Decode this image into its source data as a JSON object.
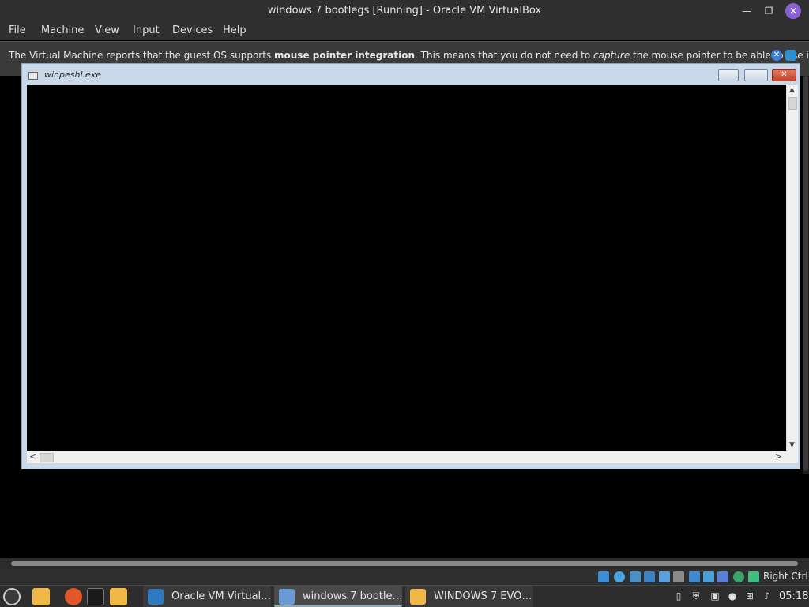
{
  "window": {
    "title": "windows 7 bootlegs [Running] - Oracle VM VirtualBox",
    "min_glyph": "—",
    "max_glyph": "❐",
    "close_glyph": "✕"
  },
  "menu": {
    "items": [
      "File",
      "Machine",
      "View",
      "Input",
      "Devices",
      "Help"
    ]
  },
  "notice": {
    "text_1": "The Virtual Machine reports that the guest OS supports ",
    "bold": "mouse pointer integration",
    "text_2": ". This means that you do not need to ",
    "italic": "capture",
    "text_3": " the mouse pointer to be able to use it in your",
    "close_glyph": "✕"
  },
  "guest": {
    "title": "winpeshl.exe",
    "close_glyph": "✕",
    "scroll_up": "▲",
    "scroll_down": "▼",
    "scroll_left": "<",
    "scroll_right": ">"
  },
  "statusbar": {
    "host_key": "Right Ctrl",
    "icons": [
      "optical-drive-icon",
      "hard-disk-icon",
      "audio-icon",
      "network-icon",
      "usb-icon",
      "shared-folders-icon",
      "display-icon",
      "video-capture-icon",
      "virtualization-icon",
      "cpu-icon",
      "mouse-integration-icon"
    ]
  },
  "panel": {
    "tasks": [
      {
        "label": "Oracle VM Virtual…",
        "icon": "virtualbox-icon",
        "active": false
      },
      {
        "label": "windows 7 bootle…",
        "icon": "virtualbox-vm-icon",
        "active": true
      },
      {
        "label": "WINDOWS 7 EVO…",
        "icon": "folder-icon",
        "active": false
      }
    ],
    "clock": "05:18"
  },
  "colors": {
    "titlebar": "#2f2f2f",
    "close_button": "#8a63d2",
    "guest_frame": "#c9d9ea",
    "guest_close": "#c1452a"
  }
}
